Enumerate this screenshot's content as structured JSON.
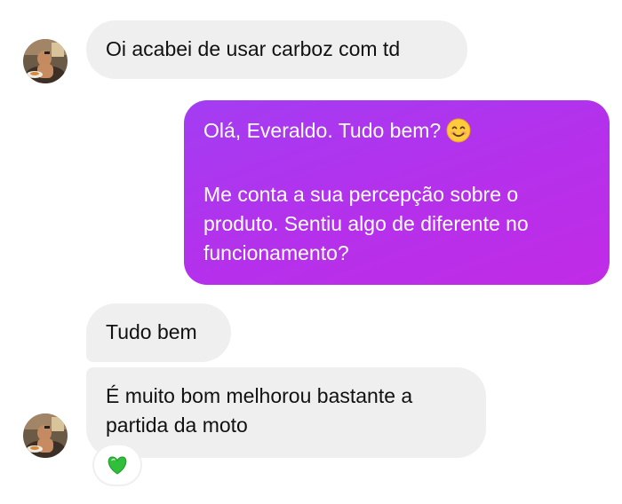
{
  "thread": {
    "messages": [
      {
        "direction": "incoming",
        "lines": [
          "Oi acabei de usar carboz com td"
        ]
      },
      {
        "direction": "outgoing",
        "paragraphs": [
          {
            "lines": [
              "Olá, Everaldo. Tudo bem?"
            ],
            "trailing_icon": "smiling-face-emoji"
          },
          {
            "lines": [
              "Me conta a sua percepção sobre o",
              "produto. Sentiu algo de diferente no",
              "funcionamento?"
            ]
          }
        ]
      },
      {
        "direction": "incoming",
        "lines": [
          "Tudo bem"
        ]
      },
      {
        "direction": "incoming",
        "lines": [
          "É muito bom melhorou bastante a",
          "partida da moto"
        ],
        "reaction": "green-heart-emoji"
      }
    ]
  },
  "colors": {
    "incoming_bubble": "#efefef",
    "outgoing_bubble_gradient": [
      "#a33df2",
      "#c12be6"
    ],
    "text_dark": "#111111",
    "text_light": "#ffffff",
    "reaction_heart": "#2fbf3a"
  }
}
